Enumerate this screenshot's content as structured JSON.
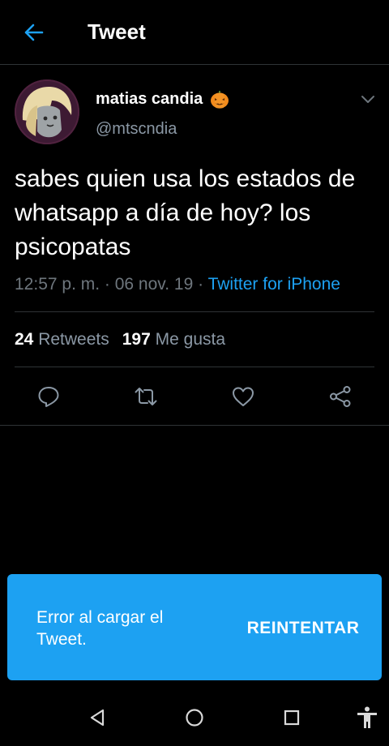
{
  "header": {
    "title": "Tweet",
    "back_icon": "arrow-left-icon"
  },
  "tweet": {
    "author_name": "matias candia",
    "author_emoji": "jack-o-lantern-icon",
    "author_handle": "@mtscndia",
    "text": "sabes quien usa los estados de whatsapp a día de hoy? los psicopatas",
    "time": "12:57 p. m.",
    "separator": " · ",
    "date": "06 nov. 19",
    "client": "Twitter for iPhone",
    "retweet_count": "24",
    "retweet_label": "Retweets",
    "like_count": "197",
    "like_label": "Me gusta"
  },
  "actions": [
    "reply-icon",
    "retweet-icon",
    "like-icon",
    "share-icon"
  ],
  "toast": {
    "message": "Error al cargar el Tweet.",
    "action_label": "REINTENTAR"
  },
  "navbar": [
    "back-triangle-icon",
    "home-circle-icon",
    "recents-square-icon",
    "accessibility-icon"
  ],
  "colors": {
    "background": "#000000",
    "accent": "#1da1f2",
    "secondary_text": "#8b98a5",
    "divider": "#2f3336"
  }
}
